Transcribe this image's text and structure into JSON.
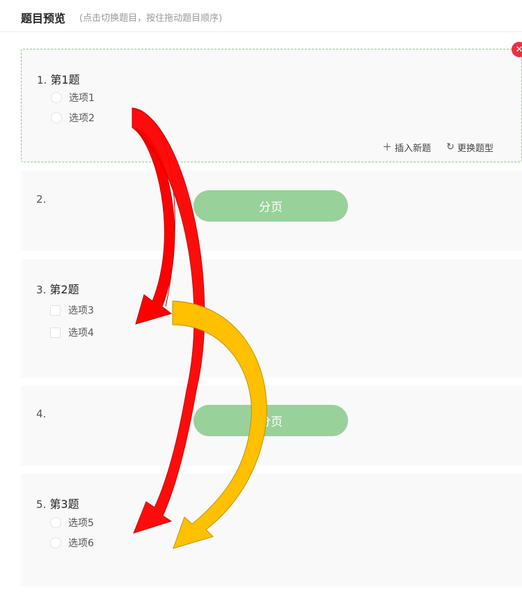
{
  "header": {
    "title": "题目预览",
    "subtitle": "(点击切换题目，按住拖动题目顺序)"
  },
  "questions": [
    {
      "num": "1.",
      "title": "第1题",
      "type": "radio",
      "options": [
        "选项1",
        "选项2"
      ]
    },
    {
      "num": "3.",
      "title": "第2题",
      "type": "checkbox",
      "options": [
        "选项3",
        "选项4"
      ]
    },
    {
      "num": "5.",
      "title": "第3题",
      "type": "radio",
      "options": [
        "选项5",
        "选项6"
      ]
    }
  ],
  "page_breaks": [
    {
      "num": "2.",
      "label": "分页"
    },
    {
      "num": "4.",
      "label": "分页"
    }
  ],
  "actions": {
    "insert_label": "插入新题",
    "insert_icon": "plus-icon",
    "change_label": "更换题型",
    "change_icon": "refresh-icon"
  },
  "close_icon": "close-icon",
  "colors": {
    "selected_border": "#7dd07d",
    "page_break": "#98d19a",
    "close": "#e8323f",
    "arrow_red": "#ff0000",
    "arrow_yellow": "#ffc000"
  }
}
